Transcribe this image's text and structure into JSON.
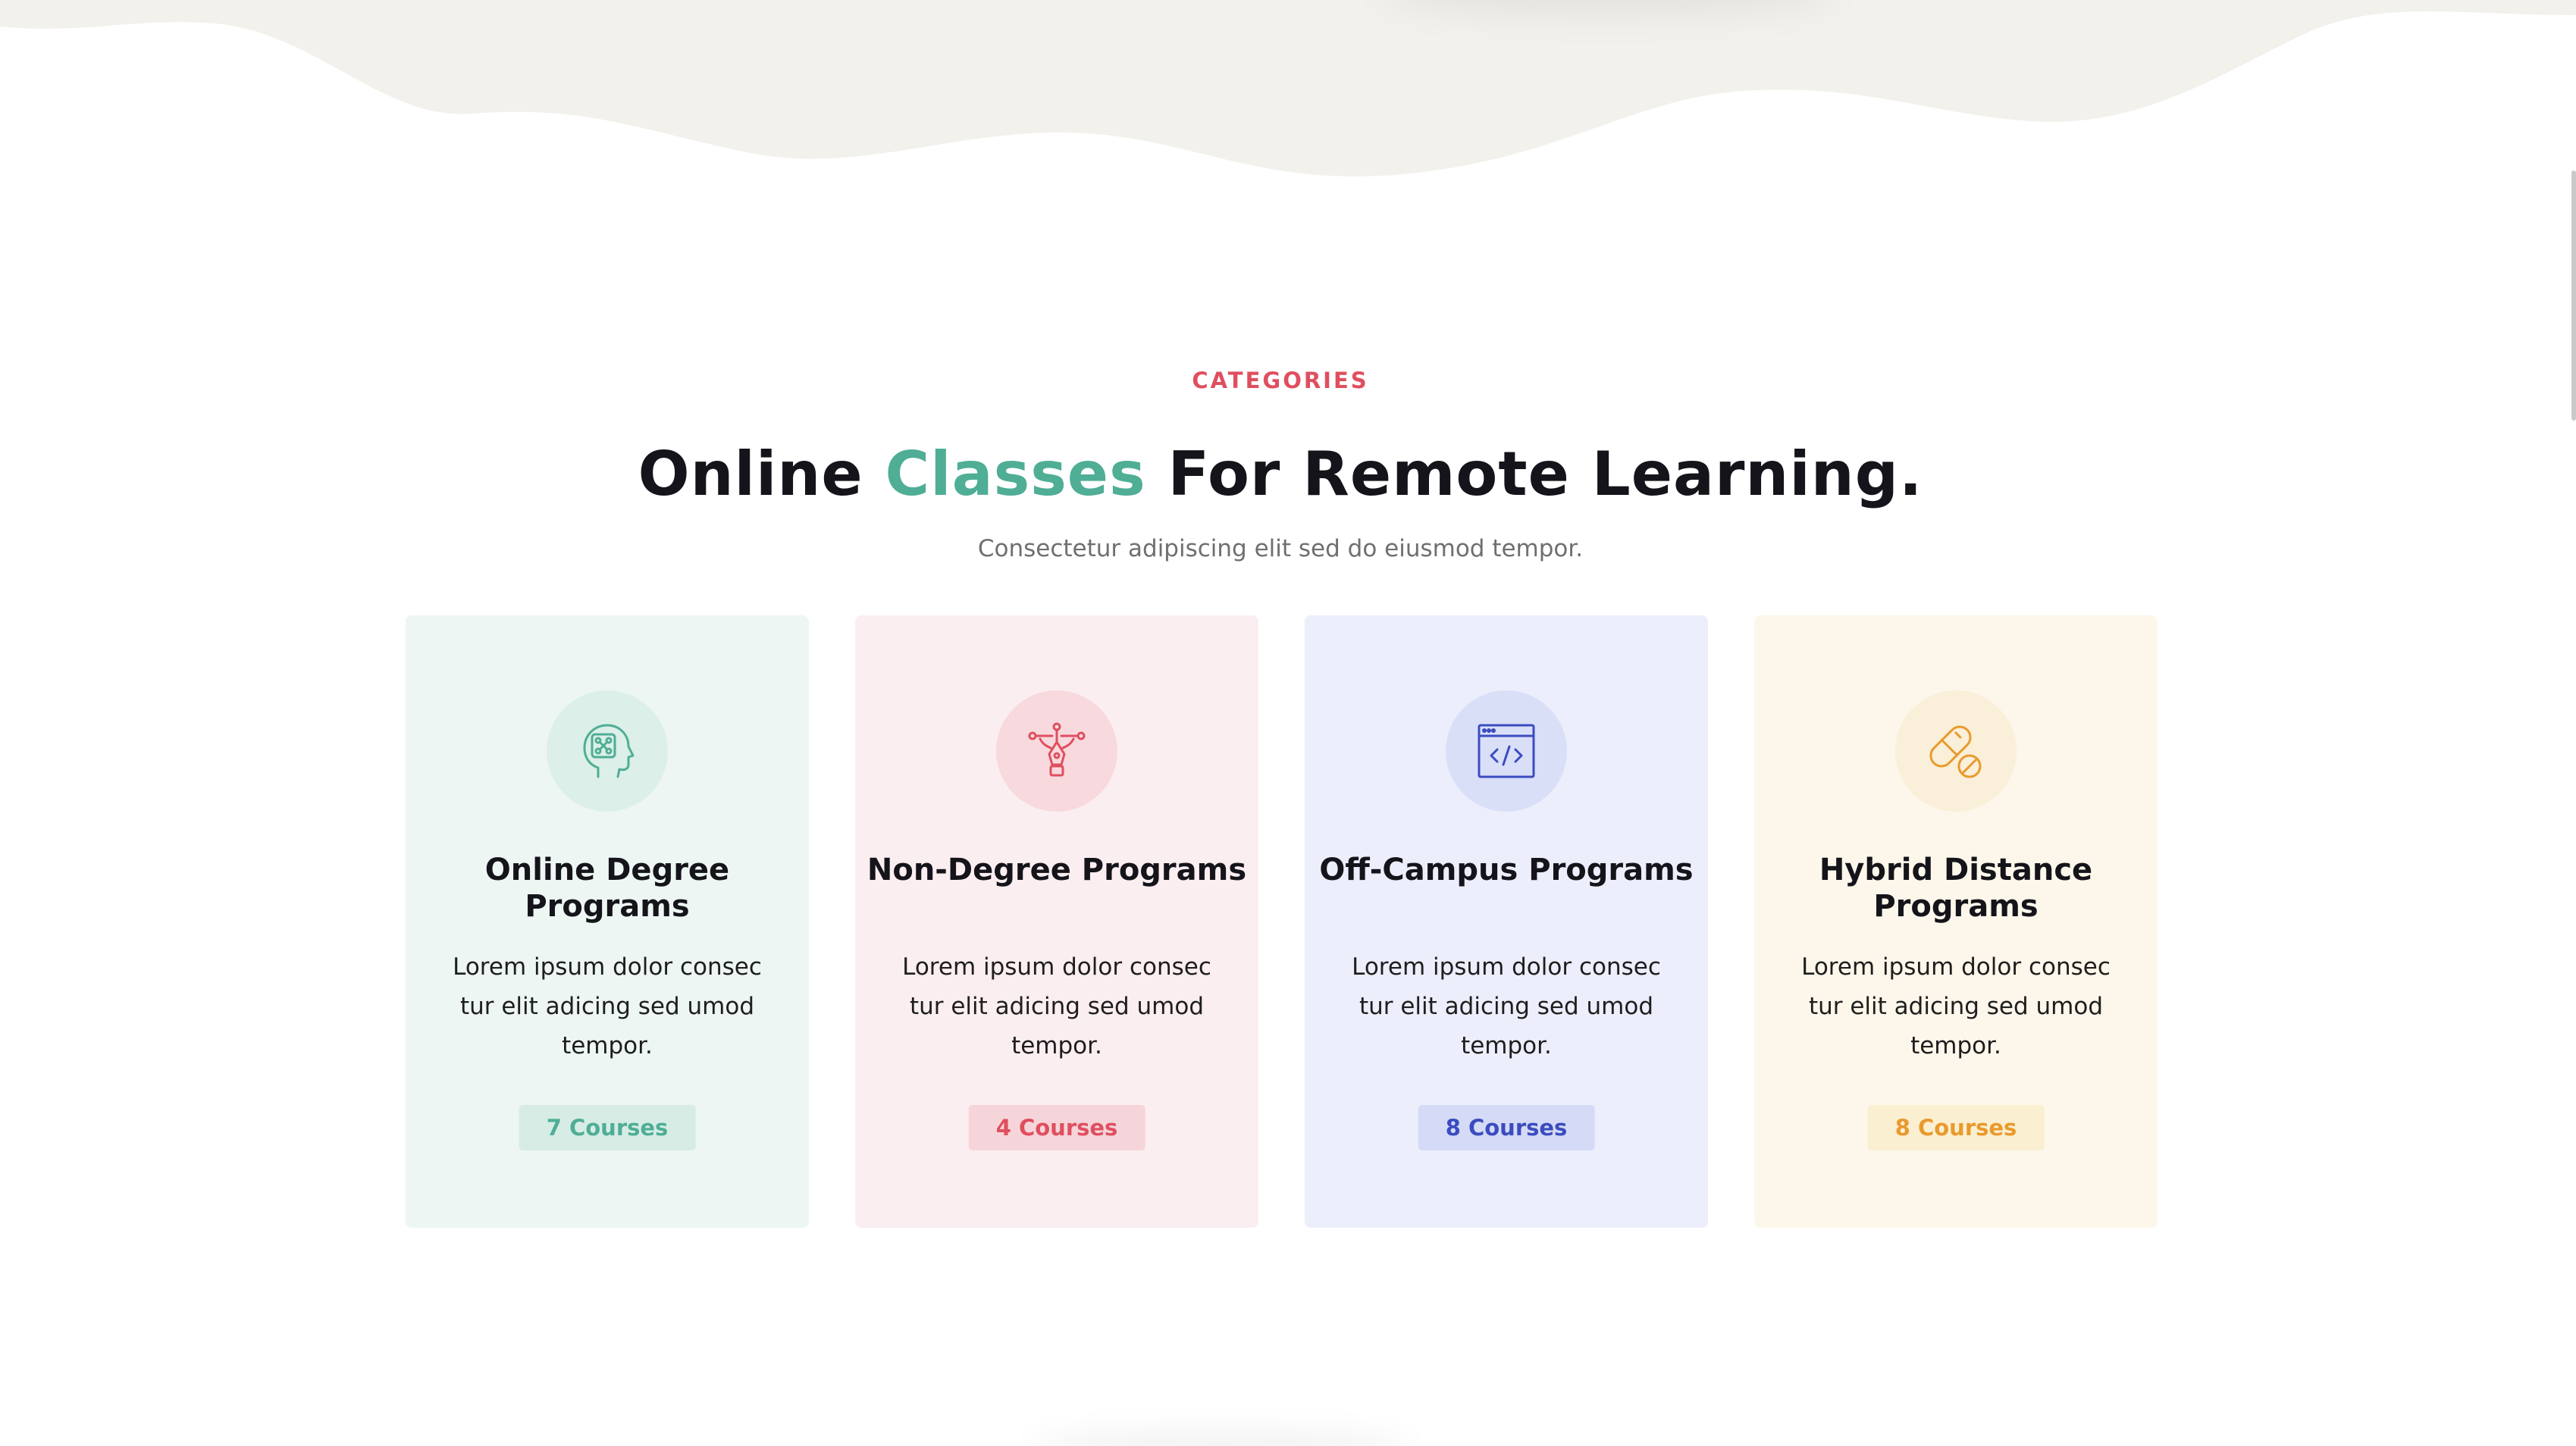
{
  "colors": {
    "wave": "#f3f1ec",
    "eyebrow": "#df4f5f",
    "title_accent": "#4fae95",
    "heading": "#14141a",
    "subtitle": "#6f6f6f"
  },
  "section": {
    "eyebrow": "CATEGORIES",
    "title_part1": "Online ",
    "title_accent": "Classes",
    "title_part2": " For Remote Learning.",
    "subtitle": "Consectetur adipiscing elit sed do eiusmod tempor."
  },
  "cards": [
    {
      "icon": "brain-head-icon",
      "title": "Online Degree Programs",
      "text": "Lorem ipsum dolor consec tur elit adicing sed umod tempor.",
      "badge": "7 Courses",
      "bg": "#edf6f3",
      "icon_bg": "#dcefe8",
      "accent": "#4fae95",
      "badge_bg": "#d7ece5"
    },
    {
      "icon": "pen-tool-icon",
      "title": "Non-Degree Programs",
      "text": "Lorem ipsum dolor consec tur elit adicing sed umod tempor.",
      "badge": "4 Courses",
      "bg": "#fbeef0",
      "icon_bg": "#f8d9de",
      "accent": "#df4f5f",
      "badge_bg": "#f6d5da"
    },
    {
      "icon": "code-window-icon",
      "title": "Off-Campus Programs",
      "text": "Lorem ipsum dolor consec tur elit adicing sed umod tempor.",
      "badge": "8 Courses",
      "bg": "#eceefb",
      "icon_bg": "#dadff8",
      "accent": "#3b4cc0",
      "badge_bg": "#d5daf6"
    },
    {
      "icon": "pills-icon",
      "title": "Hybrid Distance Programs",
      "text": "Lorem ipsum dolor consec tur elit adicing sed umod tempor.",
      "badge": "8 Courses",
      "bg": "#fcf7ea",
      "icon_bg": "#faefd8",
      "accent": "#e99a2c",
      "badge_bg": "#fbefd2"
    }
  ]
}
